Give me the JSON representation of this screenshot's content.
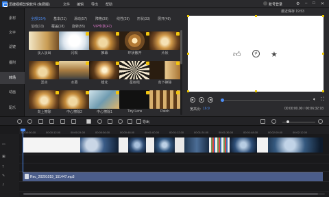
{
  "window": {
    "title": "迅捷视频剪辑软件 (免费版)",
    "menus": [
      "文件",
      "编辑",
      "导出",
      "帮助"
    ],
    "login": "账号登录"
  },
  "sidebar": {
    "items": [
      "素材",
      "文字",
      "滤镜",
      "叠附",
      "转场",
      "动画",
      "配乐"
    ]
  },
  "effects": {
    "tabs_row1": [
      "全部(314)",
      "基本(21)",
      "滑动(57)",
      "障格(39)",
      "线性(29)",
      "形状(33)",
      "展开(48)"
    ],
    "tabs_row2": [
      "溶动(13)",
      "覆盖(18)",
      "旋转(55)",
      "VIP专享(47)"
    ],
    "items": [
      "淡入淡出",
      "闪现",
      "推幕",
      "环状散开",
      "片状",
      "滤点",
      "水幕",
      "模化",
      "星射线",
      "向下擦除",
      "向上擦除",
      "中心擦除2",
      "中心擦除1",
      "Tiny Lens",
      "Patch"
    ]
  },
  "preview": {
    "autosave": "最近保存 19:53",
    "icons": [
      "thumbs-up-icon",
      "not-equal-icon",
      "star-icon"
    ],
    "ratio_label": "宽高比:",
    "ratio_value": "16:9",
    "time_current": "00:00:00.00",
    "time_total": "00:06:32.93"
  },
  "toolbar": {
    "export_label": "导出"
  },
  "timeline": {
    "ruler_ticks": [
      "00:00:00.00",
      "00:00:12.00",
      "00:00:24.00",
      "00:00:36.00",
      "00:00:48.00",
      "00:01:00.00",
      "00:01:12.00",
      "00:01:24.00",
      "00:01:36.00",
      "00:01:48.00",
      "00:02:00.00",
      "00:02:12.00"
    ],
    "audio_clip": "Rec_20201019_151447.mp3"
  },
  "colors": {
    "accent": "#4d8ef7",
    "vip": "#e07acd",
    "audio_clip": "#4b5d8a"
  }
}
